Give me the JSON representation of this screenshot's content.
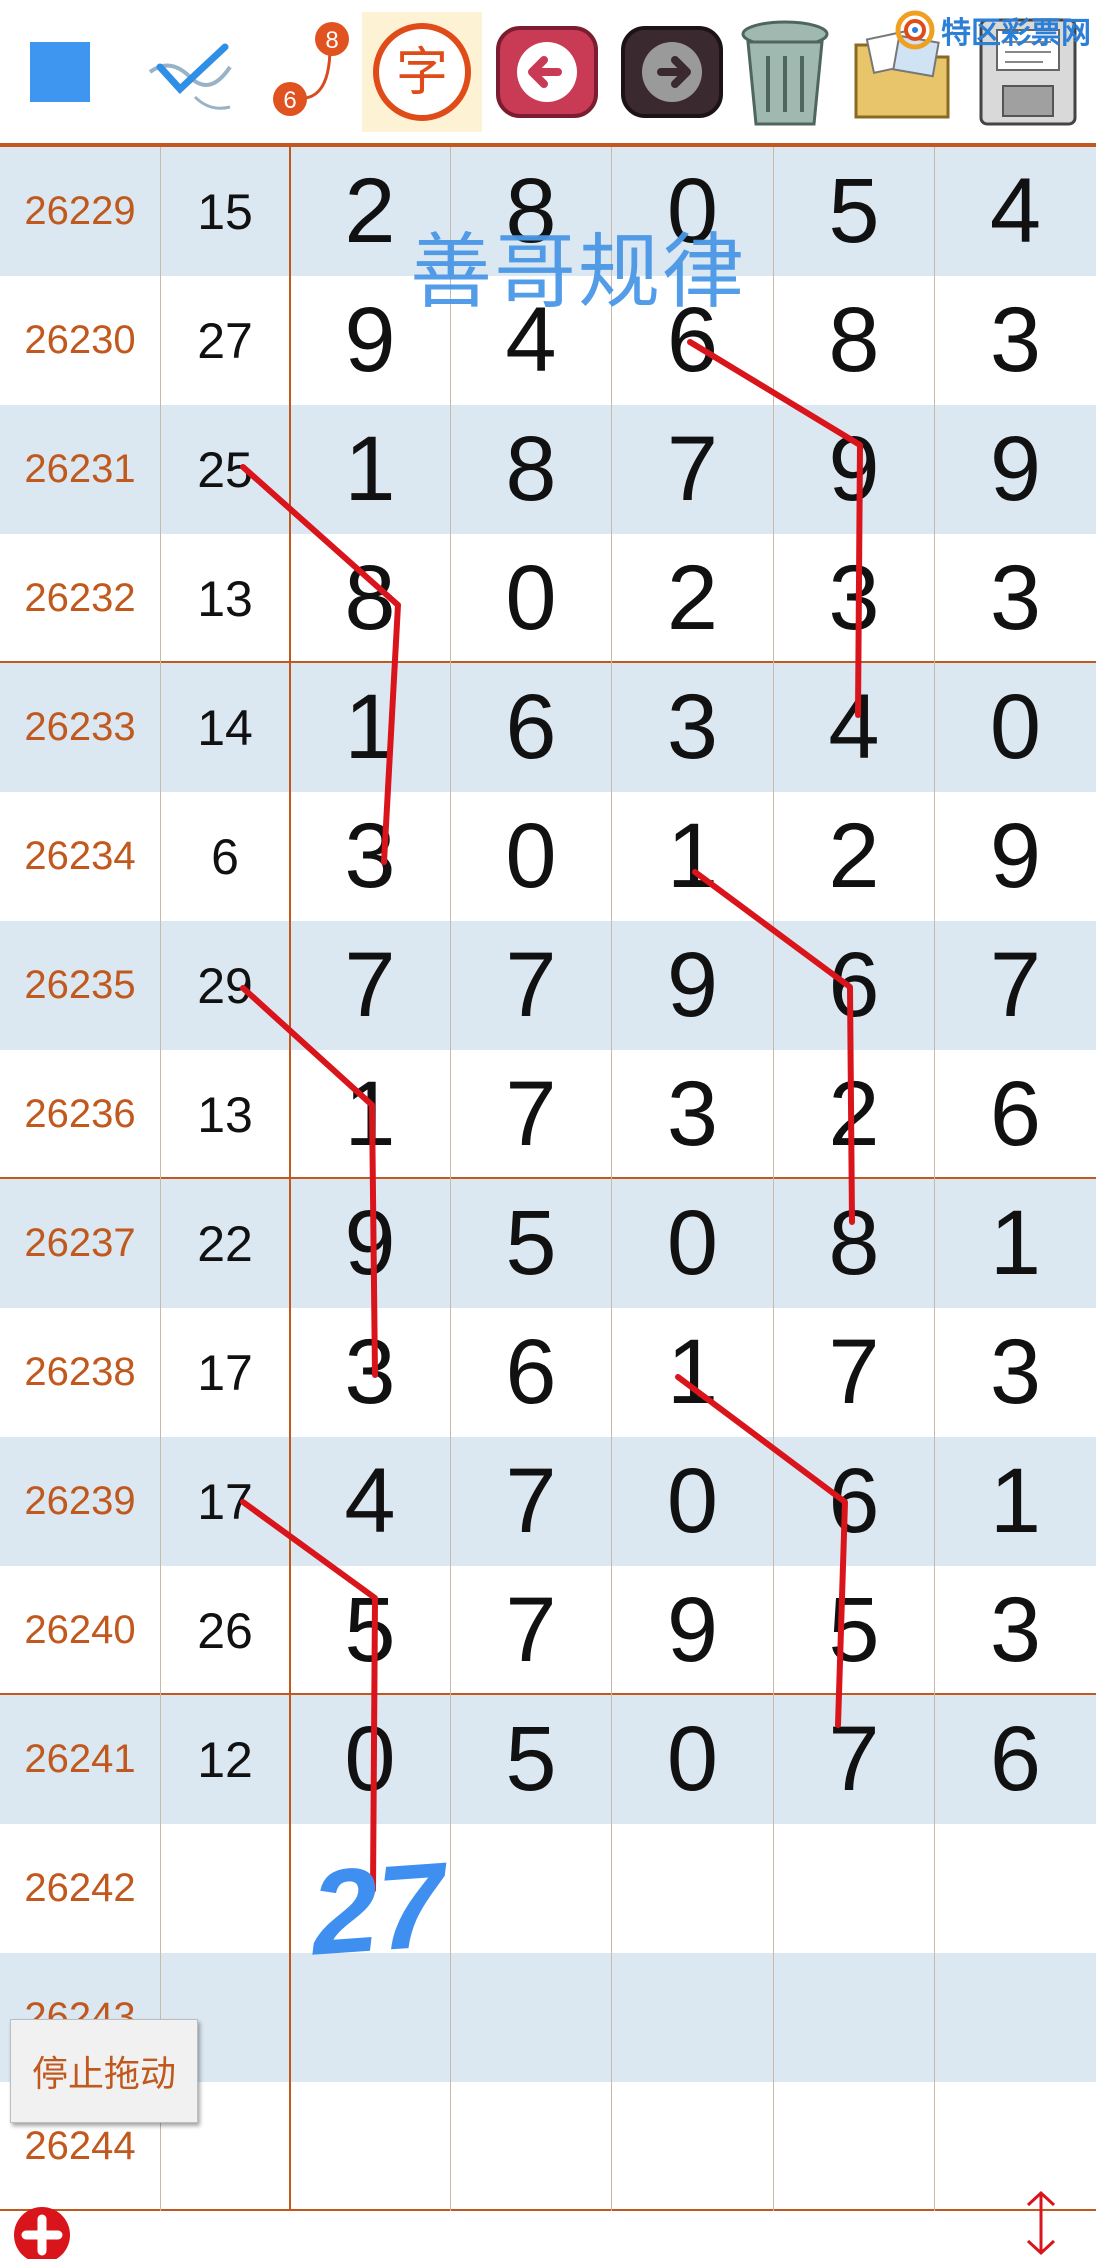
{
  "brand": {
    "name": "特区彩票网"
  },
  "toolbar": {
    "char_label": "字",
    "dot_number_top": "8",
    "dot_number_bottom": "6",
    "icons": [
      "blue-square-icon",
      "checkmark-pen-icon",
      "number-link-icon",
      "char-mode-icon",
      "back-arrow-icon",
      "forward-arrow-icon",
      "trash-icon",
      "folder-photos-icon",
      "floppy-save-icon"
    ]
  },
  "title_overlay": "善哥规律",
  "rows": [
    {
      "issue": "26229",
      "sum": "15",
      "digits": [
        "2",
        "8",
        "0",
        "5",
        "4"
      ]
    },
    {
      "issue": "26230",
      "sum": "27",
      "digits": [
        "9",
        "4",
        "6",
        "8",
        "3"
      ]
    },
    {
      "issue": "26231",
      "sum": "25",
      "digits": [
        "1",
        "8",
        "7",
        "9",
        "9"
      ]
    },
    {
      "issue": "26232",
      "sum": "13",
      "digits": [
        "8",
        "0",
        "2",
        "3",
        "3"
      ]
    },
    {
      "issue": "26233",
      "sum": "14",
      "digits": [
        "1",
        "6",
        "3",
        "4",
        "0"
      ]
    },
    {
      "issue": "26234",
      "sum": "6",
      "digits": [
        "3",
        "0",
        "1",
        "2",
        "9"
      ]
    },
    {
      "issue": "26235",
      "sum": "29",
      "digits": [
        "7",
        "7",
        "9",
        "6",
        "7"
      ]
    },
    {
      "issue": "26236",
      "sum": "13",
      "digits": [
        "1",
        "7",
        "3",
        "2",
        "6"
      ]
    },
    {
      "issue": "26237",
      "sum": "22",
      "digits": [
        "9",
        "5",
        "0",
        "8",
        "1"
      ]
    },
    {
      "issue": "26238",
      "sum": "17",
      "digits": [
        "3",
        "6",
        "1",
        "7",
        "3"
      ]
    },
    {
      "issue": "26239",
      "sum": "17",
      "digits": [
        "4",
        "7",
        "0",
        "6",
        "1"
      ]
    },
    {
      "issue": "26240",
      "sum": "26",
      "digits": [
        "5",
        "7",
        "9",
        "5",
        "3"
      ]
    },
    {
      "issue": "26241",
      "sum": "12",
      "digits": [
        "0",
        "5",
        "0",
        "7",
        "6"
      ]
    },
    {
      "issue": "26242",
      "sum": "",
      "digits": [
        "",
        "",
        "",
        "",
        ""
      ]
    },
    {
      "issue": "26243",
      "sum": "",
      "digits": [
        "",
        "",
        "",
        "",
        ""
      ]
    },
    {
      "issue": "26244",
      "sum": "",
      "digits": [
        "",
        "",
        "",
        "",
        ""
      ]
    }
  ],
  "handwriting": {
    "prediction": "27"
  },
  "stop_drag_label": "停止拖动",
  "colors": {
    "accent": "#c1591e",
    "alt_row": "#dbe8f2",
    "ink_red": "#d9141b",
    "ink_blue": "#3f8ff0"
  }
}
